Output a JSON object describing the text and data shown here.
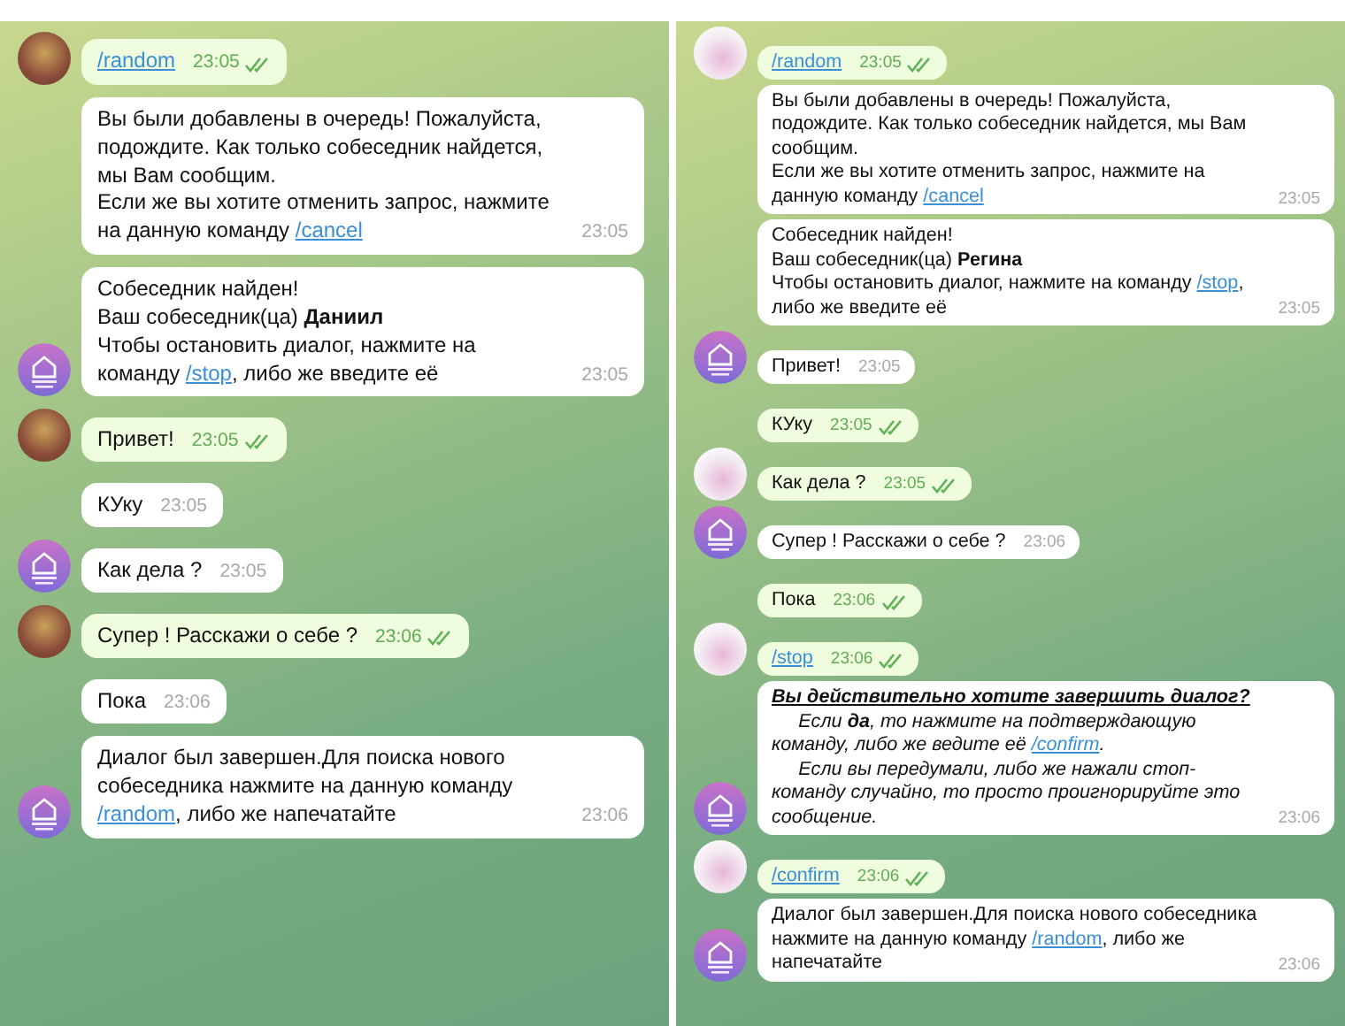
{
  "panels": [
    {
      "messages": [
        {
          "kind": "outgoing",
          "avatar": true,
          "read": true,
          "time": "23:05",
          "paragraphs": [
            {
              "kind": "plain",
              "segments": [
                {
                  "kind": "link",
                  "text": "/random"
                }
              ]
            }
          ]
        },
        {
          "kind": "incoming",
          "avatar": false,
          "read": false,
          "time": "23:05",
          "paragraphs": [
            {
              "kind": "plain",
              "segments": [
                {
                  "kind": "text",
                  "text": "Вы были добавлены в очередь! Пожалуйста, подождите. Как только собеседник найдется, мы Вам сообщим."
                }
              ]
            },
            {
              "kind": "plain",
              "segments": [
                {
                  "kind": "text",
                  "text": "Если же вы хотите отменить запрос, нажмите на данную команду"
                },
                {
                  "kind": "link",
                  "text": "/cancel"
                }
              ]
            }
          ]
        },
        {
          "kind": "incoming",
          "avatar": true,
          "read": false,
          "time": "23:05",
          "paragraphs": [
            {
              "kind": "plain",
              "segments": [
                {
                  "kind": "text",
                  "text": "Собеседник найден!"
                }
              ]
            },
            {
              "kind": "plain",
              "segments": [
                {
                  "kind": "text",
                  "text": "Ваш собеседник(ца) **Даниил**"
                }
              ]
            },
            {
              "kind": "plain",
              "segments": [
                {
                  "kind": "text",
                  "text": "Чтобы остановить диалог, нажмите на команду"
                },
                {
                  "kind": "link",
                  "text": "/stop"
                },
                {
                  "kind": "text",
                  "text": ", либо же введите её"
                }
              ]
            }
          ]
        },
        {
          "kind": "outgoing",
          "avatar": true,
          "read": true,
          "time": "23:05",
          "paragraphs": [
            {
              "kind": "plain",
              "segments": [
                {
                  "kind": "text",
                  "text": "Привет!"
                }
              ]
            }
          ]
        },
        {
          "kind": "incoming",
          "avatar": false,
          "read": false,
          "time": "23:05",
          "paragraphs": [
            {
              "kind": "plain",
              "segments": [
                {
                  "kind": "text",
                  "text": "КУку"
                }
              ]
            }
          ]
        },
        {
          "kind": "incoming",
          "avatar": true,
          "read": false,
          "time": "23:05",
          "paragraphs": [
            {
              "kind": "plain",
              "segments": [
                {
                  "kind": "text",
                  "text": "Как дела ?"
                }
              ]
            }
          ]
        },
        {
          "kind": "outgoing",
          "avatar": true,
          "read": true,
          "time": "23:06",
          "paragraphs": [
            {
              "kind": "plain",
              "segments": [
                {
                  "kind": "text",
                  "text": "Супер ! Расскажи о себе ?"
                }
              ]
            }
          ]
        },
        {
          "kind": "incoming",
          "avatar": false,
          "read": false,
          "time": "23:06",
          "paragraphs": [
            {
              "kind": "plain",
              "segments": [
                {
                  "kind": "text",
                  "text": "Пока"
                }
              ]
            }
          ]
        },
        {
          "kind": "incoming",
          "avatar": true,
          "read": false,
          "time": "23:06",
          "paragraphs": [
            {
              "kind": "plain",
              "segments": [
                {
                  "kind": "text",
                  "text": "Диалог был завершен.Для поиска нового собеседника нажмите на данную команду"
                },
                {
                  "kind": "link",
                  "text": "/random"
                },
                {
                  "kind": "text",
                  "text": ", либо же напечатайте"
                }
              ]
            }
          ]
        }
      ]
    },
    {
      "messages": [
        {
          "kind": "outgoing",
          "avatar": true,
          "read": true,
          "time": "23:05",
          "paragraphs": [
            {
              "kind": "plain",
              "segments": [
                {
                  "kind": "link",
                  "text": "/random"
                }
              ]
            }
          ]
        },
        {
          "kind": "incoming",
          "avatar": false,
          "read": false,
          "time": "23:05",
          "paragraphs": [
            {
              "kind": "plain",
              "segments": [
                {
                  "kind": "text",
                  "text": "Вы были добавлены в очередь! Пожалуйста, подождите. Как только собеседник найдется, мы Вам сообщим."
                }
              ]
            },
            {
              "kind": "plain",
              "segments": [
                {
                  "kind": "text",
                  "text": "Если же вы хотите отменить запрос, нажмите на данную команду"
                },
                {
                  "kind": "link",
                  "text": "/cancel"
                }
              ]
            }
          ]
        },
        {
          "kind": "incoming",
          "avatar": false,
          "read": false,
          "time": "23:05",
          "paragraphs": [
            {
              "kind": "plain",
              "segments": [
                {
                  "kind": "text",
                  "text": "Собеседник найден!"
                }
              ]
            },
            {
              "kind": "plain",
              "segments": [
                {
                  "kind": "text",
                  "text": "Ваш собеседник(ца) **Регина**"
                }
              ]
            },
            {
              "kind": "plain",
              "segments": [
                {
                  "kind": "text",
                  "text": "Чтобы остановить диалог, нажмите на команду"
                },
                {
                  "kind": "link",
                  "text": "/stop"
                },
                {
                  "kind": "text",
                  "text": ", либо же введите её"
                }
              ]
            }
          ]
        },
        {
          "kind": "incoming",
          "avatar": true,
          "read": false,
          "time": "23:05",
          "paragraphs": [
            {
              "kind": "plain",
              "segments": [
                {
                  "kind": "text",
                  "text": "Привет!"
                }
              ]
            }
          ]
        },
        {
          "kind": "outgoing",
          "avatar": false,
          "read": true,
          "time": "23:05",
          "paragraphs": [
            {
              "kind": "plain",
              "segments": [
                {
                  "kind": "text",
                  "text": "КУку"
                }
              ]
            }
          ]
        },
        {
          "kind": "outgoing",
          "avatar": true,
          "read": true,
          "time": "23:05",
          "paragraphs": [
            {
              "kind": "plain",
              "segments": [
                {
                  "kind": "text",
                  "text": "Как дела ?"
                }
              ]
            }
          ]
        },
        {
          "kind": "incoming",
          "avatar": true,
          "read": false,
          "time": "23:06",
          "paragraphs": [
            {
              "kind": "plain",
              "segments": [
                {
                  "kind": "text",
                  "text": "Супер ! Расскажи о себе ?"
                }
              ]
            }
          ]
        },
        {
          "kind": "outgoing",
          "avatar": false,
          "read": true,
          "time": "23:06",
          "paragraphs": [
            {
              "kind": "plain",
              "segments": [
                {
                  "kind": "text",
                  "text": "Пока"
                }
              ]
            }
          ]
        },
        {
          "kind": "outgoing",
          "avatar": true,
          "read": true,
          "time": "23:06",
          "paragraphs": [
            {
              "kind": "plain",
              "segments": [
                {
                  "kind": "link",
                  "text": "/stop"
                }
              ]
            }
          ]
        },
        {
          "kind": "incoming",
          "avatar": true,
          "read": false,
          "italic": true,
          "time": "23:06",
          "paragraphs": [
            {
              "kind": "heading",
              "segments": [
                {
                  "kind": "text",
                  "text": "Вы действительно хотите завершить диалог?"
                }
              ]
            },
            {
              "kind": "indented",
              "segments": [
                {
                  "kind": "text",
                  "text": "Если **да**, то нажмите на подтверждающую команду, либо же ведите её"
                },
                {
                  "kind": "link",
                  "text": "/confirm"
                },
                {
                  "kind": "text",
                  "text": "."
                }
              ]
            },
            {
              "kind": "indented",
              "segments": [
                {
                  "kind": "text",
                  "text": "Если вы передумали, либо же нажали стоп-команду случайно, то просто проигнорируйте это сообщение."
                }
              ]
            }
          ]
        },
        {
          "kind": "outgoing",
          "avatar": true,
          "read": true,
          "time": "23:06",
          "paragraphs": [
            {
              "kind": "plain",
              "segments": [
                {
                  "kind": "link",
                  "text": "/confirm"
                }
              ]
            }
          ]
        },
        {
          "kind": "incoming",
          "avatar": true,
          "read": false,
          "time": "23:06",
          "paragraphs": [
            {
              "kind": "plain",
              "segments": [
                {
                  "kind": "text",
                  "text": "Диалог был завершен.Для поиска нового собеседника нажмите на данную команду"
                },
                {
                  "kind": "link",
                  "text": "/random"
                },
                {
                  "kind": "text",
                  "text": ", либо же напечатайте"
                }
              ]
            }
          ]
        }
      ]
    }
  ]
}
